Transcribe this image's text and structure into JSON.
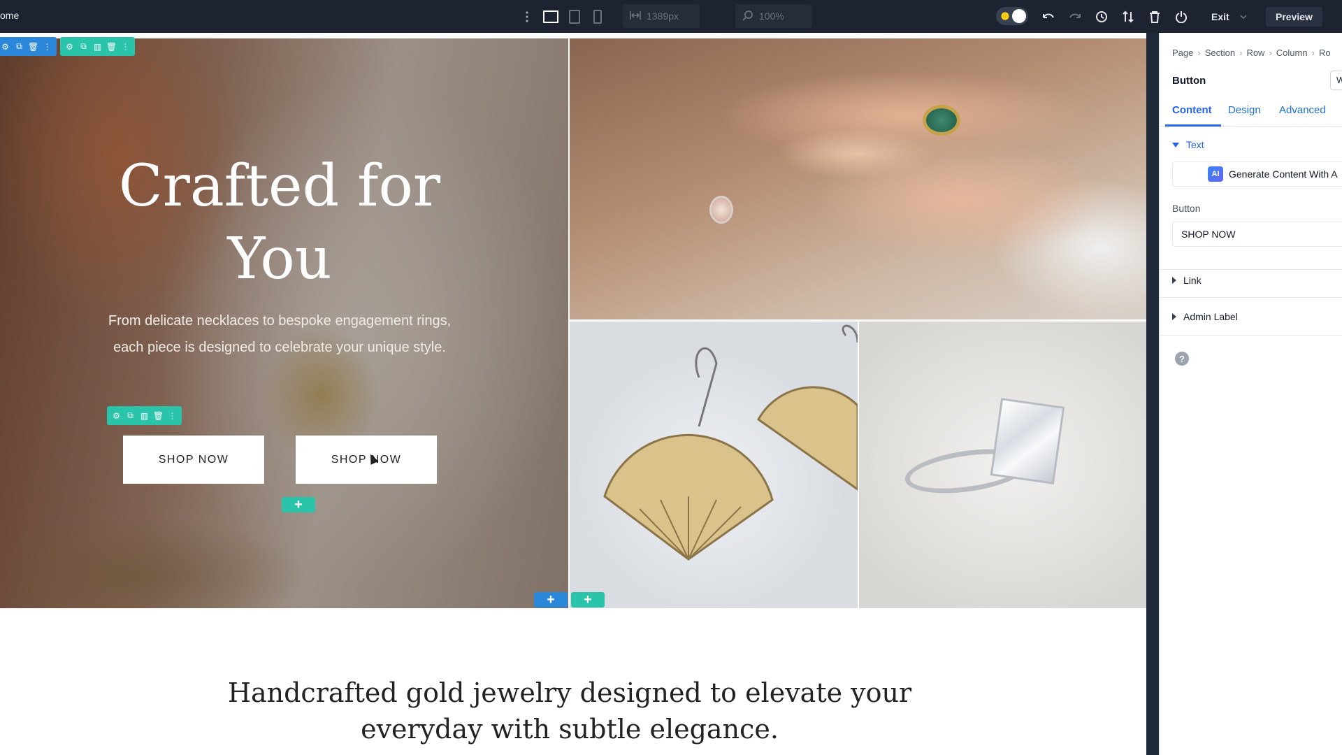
{
  "toolbar": {
    "home_label": "ome",
    "width_readout": "1389px",
    "zoom_readout": "100%",
    "exit_label": "Exit",
    "preview_label": "Preview",
    "icons": [
      "kebab-icon",
      "desktop-view-icon",
      "tablet-view-icon",
      "phone-view-icon",
      "width-icon",
      "zoom-icon",
      "undo-icon",
      "redo-icon",
      "history-icon",
      "sort-icon",
      "trash-icon",
      "power-icon",
      "chevron-down-icon"
    ]
  },
  "canvas": {
    "hero": {
      "title": "Crafted for You",
      "subtitle": "From delicate necklaces to bespoke engagement rings, each piece is designed to celebrate your unique style.",
      "button_1": "SHOP NOW",
      "button_2": "SHOP NOW"
    },
    "tagline": "Handcrafted gold jewelry designed to elevate your everyday with subtle elegance.",
    "builder_colors": {
      "blue": "#2b87da",
      "green": "#29c4a9"
    }
  },
  "panel": {
    "breadcrumb": [
      "Page",
      "Section",
      "Row",
      "Column",
      "Ro"
    ],
    "title": "Button",
    "title_box_value": "W",
    "tabs": [
      "Content",
      "Design",
      "Advanced"
    ],
    "active_tab": "Content",
    "text_section": "Text",
    "ai_badge": "AI",
    "ai_button": "Generate Content With A",
    "button_field_label": "Button",
    "button_field_value": "SHOP NOW",
    "link_section": "Link",
    "admin_label_section": "Admin Label",
    "help_glyph": "?"
  }
}
